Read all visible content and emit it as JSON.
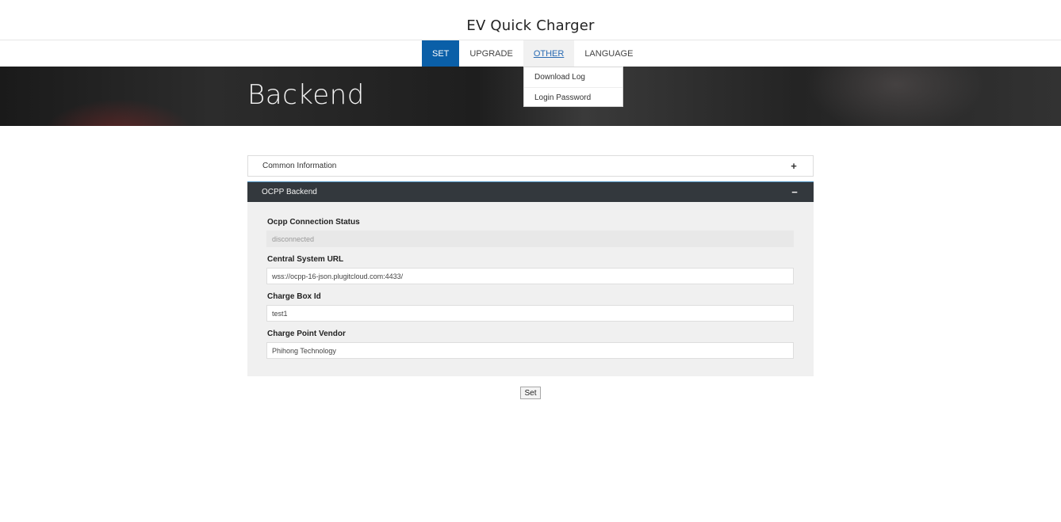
{
  "header": {
    "title": "EV Quick Charger"
  },
  "nav": {
    "items": [
      {
        "label": "SET"
      },
      {
        "label": "UPGRADE"
      },
      {
        "label": "OTHER"
      },
      {
        "label": "LANGUAGE"
      }
    ],
    "active": "SET",
    "open_menu": "OTHER",
    "dropdown": [
      {
        "label": "Download Log"
      },
      {
        "label": "Login Password"
      }
    ]
  },
  "hero": {
    "title": "Backend"
  },
  "sections": {
    "common": {
      "label": "Common Information",
      "icon": "plus-icon",
      "symbol": "+"
    },
    "ocpp": {
      "label": "OCPP Backend",
      "icon": "minus-icon",
      "symbol": "−"
    }
  },
  "form": {
    "fields": [
      {
        "label": "Ocpp Connection Status",
        "value": "disconnected",
        "readonly": true
      },
      {
        "label": "Central System URL",
        "value": "wss://ocpp-16-json.plugitcloud.com:4433/"
      },
      {
        "label": "Charge Box Id",
        "value": "test1"
      },
      {
        "label": "Charge Point Vendor",
        "value": "Phihong Technology"
      }
    ],
    "submit_label": "Set"
  },
  "colors": {
    "nav_active": "#0a5fa8",
    "section_header": "#33383d",
    "panel_body": "#f0f0f0"
  }
}
